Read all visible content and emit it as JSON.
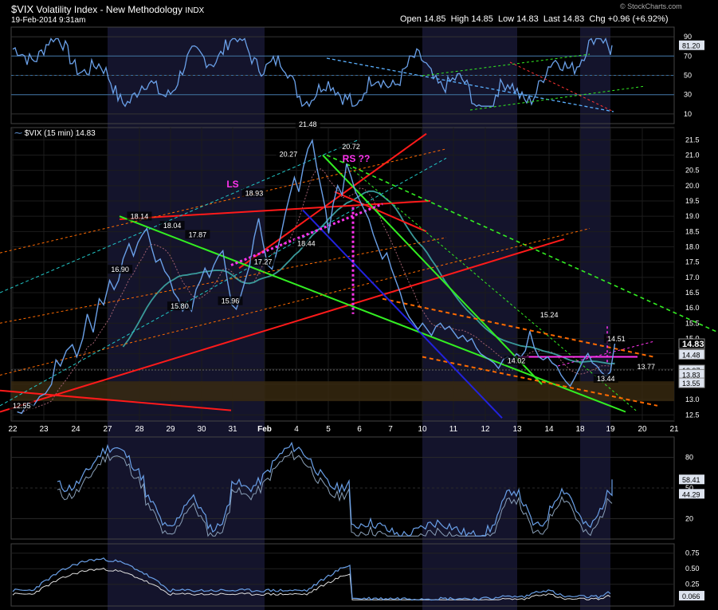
{
  "header": {
    "symbol": "$VIX",
    "name": "Volatility Index - New Methodology",
    "exchange": "INDX",
    "datetime": "19-Feb-2014 9:31am",
    "watermark": "© StockCharts.com",
    "quote": {
      "open_label": "Open",
      "open": "14.85",
      "high_label": "High",
      "high": "14.85",
      "low_label": "Low",
      "low": "14.83",
      "last_label": "Last",
      "last": "14.83",
      "chg_label": "Chg",
      "chg": "+0.96 (+6.92%)"
    }
  },
  "main_panel": {
    "legend": "$VIX (15 min) 14.83",
    "price_ticks": [
      "21.5",
      "21.0",
      "20.5",
      "20.0",
      "19.5",
      "19.0",
      "18.5",
      "18.0",
      "17.5",
      "17.0",
      "16.5",
      "16.0",
      "15.5",
      "15.0",
      "14.5",
      "14.0",
      "13.5",
      "13.0",
      "12.5"
    ],
    "right_labels": [
      "14.83",
      "14.48",
      "13.97",
      "13.83",
      "13.55"
    ],
    "annotations": [
      "LS",
      "RS ??"
    ],
    "point_labels": [
      {
        "t": 0.6,
        "v": 12.75,
        "label": "12.55"
      },
      {
        "t": 8.5,
        "v": 18.94,
        "label": "18.14"
      },
      {
        "t": 7.2,
        "v": 17.2,
        "label": "16.90"
      },
      {
        "t": 10.7,
        "v": 18.64,
        "label": "18.04"
      },
      {
        "t": 12.4,
        "v": 18.34,
        "label": "17.87"
      },
      {
        "t": 11.2,
        "v": 16.0,
        "label": "15.80"
      },
      {
        "t": 14.6,
        "v": 16.17,
        "label": "15.96"
      },
      {
        "t": 16.2,
        "v": 19.7,
        "label": "18.93"
      },
      {
        "t": 16.8,
        "v": 17.45,
        "label": "17.27"
      },
      {
        "t": 18.5,
        "v": 20.97,
        "label": "20.27"
      },
      {
        "t": 19.8,
        "v": 21.95,
        "label": "21.48"
      },
      {
        "t": 19.7,
        "v": 18.05,
        "label": "18.44"
      },
      {
        "t": 22.7,
        "v": 21.22,
        "label": "20.72"
      },
      {
        "t": 36.0,
        "v": 15.72,
        "label": "15.24"
      },
      {
        "t": 33.8,
        "v": 14.22,
        "label": "14.02"
      },
      {
        "t": 40.5,
        "v": 14.93,
        "label": "14.51"
      },
      {
        "t": 39.8,
        "v": 13.63,
        "label": "13.44"
      },
      {
        "t": 42.5,
        "v": 14.02,
        "label": "13.77"
      }
    ]
  },
  "x_axis": {
    "labels": [
      "22",
      "23",
      "24",
      "27",
      "28",
      "29",
      "30",
      "31",
      "Feb",
      "4",
      "5",
      "6",
      "7",
      "10",
      "11",
      "12",
      "13",
      "14",
      "18",
      "19",
      "20",
      "21"
    ]
  },
  "top_panel": {
    "ticks": [
      "90",
      "70",
      "50",
      "30",
      "10"
    ],
    "value_label": "81.20"
  },
  "bottom_panel1": {
    "ticks": [
      "80",
      "50",
      "20"
    ],
    "value_labels": [
      "58.41",
      "44.29"
    ]
  },
  "bottom_panel2": {
    "ticks": [
      "0.75",
      "0.50",
      "0.25"
    ],
    "value_label": "0.066"
  },
  "colors": {
    "background": "#000000",
    "shade": "#14142c",
    "price_line": "#6aa0e8",
    "red": "#ff1a1a",
    "green": "#33ee22",
    "magenta": "#ff33ee",
    "orange": "#ff6a00",
    "cyan": "#22c8c8",
    "blue": "#2222dd",
    "teal_ma": "#3a9a9a",
    "support_band": "#3a2a10"
  },
  "chart_data": {
    "type": "line",
    "title": "$VIX Volatility Index - New Methodology INDX",
    "x_categories": [
      "22",
      "23",
      "24",
      "27",
      "28",
      "29",
      "30",
      "31",
      "Feb",
      "4",
      "5",
      "6",
      "7",
      "10",
      "11",
      "12",
      "13",
      "14",
      "18",
      "19",
      "20",
      "21"
    ],
    "ylim": [
      12.3,
      21.9
    ],
    "series": [
      {
        "name": "$VIX (15 min)",
        "points": [
          [
            0.3,
            12.6
          ],
          [
            0.6,
            12.55
          ],
          [
            1.0,
            12.9
          ],
          [
            1.4,
            12.8
          ],
          [
            1.8,
            13.1
          ],
          [
            2.2,
            13.2
          ],
          [
            2.6,
            13.5
          ],
          [
            2.9,
            14.3
          ],
          [
            3.2,
            14.1
          ],
          [
            3.6,
            14.6
          ],
          [
            4.0,
            14.8
          ],
          [
            4.3,
            14.4
          ],
          [
            4.7,
            15.0
          ],
          [
            5.0,
            15.8
          ],
          [
            5.4,
            15.2
          ],
          [
            5.8,
            16.3
          ],
          [
            6.1,
            16.1
          ],
          [
            6.5,
            16.9
          ],
          [
            6.8,
            16.6
          ],
          [
            7.1,
            16.9
          ],
          [
            7.4,
            17.6
          ],
          [
            7.8,
            18.1
          ],
          [
            8.1,
            17.7
          ],
          [
            8.4,
            18.14
          ],
          [
            8.7,
            18.4
          ],
          [
            9.0,
            18.6
          ],
          [
            9.3,
            18.0
          ],
          [
            9.6,
            17.5
          ],
          [
            9.9,
            17.6
          ],
          [
            10.2,
            17.2
          ],
          [
            10.5,
            17.0
          ],
          [
            10.8,
            16.5
          ],
          [
            11.1,
            16.3
          ],
          [
            11.4,
            15.9
          ],
          [
            11.7,
            16.1
          ],
          [
            12.0,
            15.9
          ],
          [
            12.3,
            16.6
          ],
          [
            12.6,
            16.9
          ],
          [
            12.9,
            17.3
          ],
          [
            13.2,
            17.0
          ],
          [
            13.5,
            17.4
          ],
          [
            13.8,
            17.7
          ],
          [
            14.1,
            17.87
          ],
          [
            14.4,
            16.9
          ],
          [
            14.7,
            16.1
          ],
          [
            15.0,
            15.96
          ],
          [
            15.3,
            16.4
          ],
          [
            15.6,
            16.9
          ],
          [
            15.9,
            17.4
          ],
          [
            16.2,
            18.3
          ],
          [
            16.5,
            18.93
          ],
          [
            16.8,
            18.1
          ],
          [
            17.1,
            17.4
          ],
          [
            17.4,
            17.27
          ],
          [
            17.7,
            17.8
          ],
          [
            18.0,
            18.4
          ],
          [
            18.3,
            19.1
          ],
          [
            18.6,
            19.7
          ],
          [
            18.9,
            20.27
          ],
          [
            19.2,
            19.8
          ],
          [
            19.5,
            20.6
          ],
          [
            19.8,
            21.2
          ],
          [
            20.1,
            21.48
          ],
          [
            20.4,
            20.6
          ],
          [
            20.7,
            19.9
          ],
          [
            21.0,
            19.2
          ],
          [
            21.2,
            18.44
          ],
          [
            21.5,
            19.4
          ],
          [
            21.8,
            20.0
          ],
          [
            22.1,
            19.7
          ],
          [
            22.4,
            20.72
          ],
          [
            22.7,
            20.3
          ],
          [
            23.0,
            19.8
          ],
          [
            23.3,
            19.5
          ],
          [
            23.6,
            19.2
          ],
          [
            23.9,
            18.9
          ],
          [
            24.2,
            18.4
          ],
          [
            24.5,
            18.0
          ],
          [
            24.8,
            17.6
          ],
          [
            25.1,
            17.8
          ],
          [
            25.4,
            17.3
          ],
          [
            25.7,
            16.9
          ],
          [
            26.0,
            16.5
          ],
          [
            26.3,
            16.0
          ],
          [
            26.6,
            15.7
          ],
          [
            26.9,
            15.5
          ],
          [
            27.2,
            15.3
          ],
          [
            27.5,
            15.5
          ],
          [
            27.8,
            15.3
          ],
          [
            28.1,
            15.1
          ],
          [
            28.4,
            15.4
          ],
          [
            28.7,
            15.5
          ],
          [
            29.0,
            15.3
          ],
          [
            29.3,
            15.4
          ],
          [
            29.6,
            15.2
          ],
          [
            29.9,
            15.0
          ],
          [
            30.2,
            15.1
          ],
          [
            30.5,
            14.9
          ],
          [
            30.8,
            15.0
          ],
          [
            31.1,
            14.7
          ],
          [
            31.4,
            14.5
          ],
          [
            31.7,
            14.4
          ],
          [
            32.0,
            14.3
          ],
          [
            32.3,
            14.2
          ],
          [
            32.6,
            14.02
          ],
          [
            32.9,
            14.3
          ],
          [
            33.2,
            14.4
          ],
          [
            33.5,
            14.3
          ],
          [
            33.8,
            14.5
          ],
          [
            34.1,
            14.4
          ],
          [
            34.4,
            14.6
          ],
          [
            34.7,
            15.24
          ],
          [
            35.0,
            14.7
          ],
          [
            35.3,
            14.4
          ],
          [
            35.6,
            14.3
          ],
          [
            35.9,
            14.4
          ],
          [
            36.2,
            14.2
          ],
          [
            36.5,
            14.1
          ],
          [
            36.8,
            13.8
          ],
          [
            37.1,
            13.6
          ],
          [
            37.4,
            13.44
          ],
          [
            37.7,
            13.7
          ],
          [
            38.0,
            14.0
          ],
          [
            38.3,
            14.3
          ],
          [
            38.6,
            14.51
          ],
          [
            38.9,
            14.2
          ],
          [
            39.2,
            14.1
          ],
          [
            39.5,
            13.9
          ],
          [
            39.8,
            13.77
          ],
          [
            40.1,
            13.9
          ],
          [
            40.4,
            14.83
          ]
        ]
      }
    ]
  }
}
